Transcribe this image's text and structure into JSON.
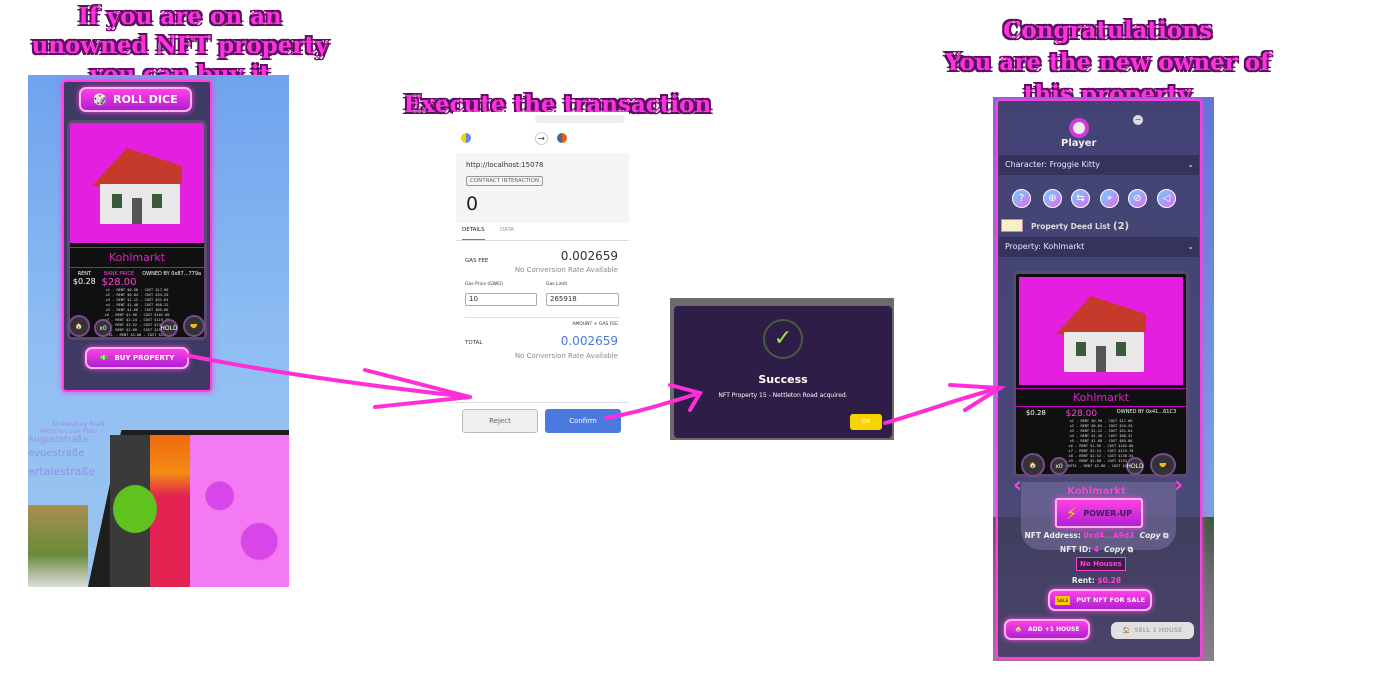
{
  "captions": {
    "step1": [
      "If you are on an",
      "unowned NFT property",
      "you can buy it"
    ],
    "step2": "Execute the transaction",
    "step3": [
      "Congratulations",
      "You are the new owner of",
      "this property"
    ]
  },
  "game_before": {
    "roll_dice_label": "ROLL DICE",
    "card": {
      "name": "Kohlmarkt",
      "rent_label": "RENT",
      "rent": "$0.28",
      "bank_price_label": "BANK PRICE",
      "bank_price": "$28.00",
      "owned_by": "OWNED BY 0x87...779a",
      "rent_rows": [
        "x1 - RENT $0.56 - COST $17.00",
        "x2 - RENT $0.84 - COST $34.20",
        "x3 - RENT $1.12 - COST $51.64",
        "x4 - RENT $1.40 - COST $68.32",
        "x5 - RENT $1.68 - COST $85.00",
        "x6 - RENT $1.96 - COST $102.00",
        "x7 - RENT $2.24 - COST $119.78",
        "x8 - RENT $2.52 - COST $136.54",
        "x9 - RENT $2.80 - COST $153.32",
        "HOTEL - RENT $3.08 - COST $19.40"
      ],
      "houses_count": "x0",
      "hold_label": "HOLD"
    },
    "buy_property_label": "BUY PROPERTY",
    "street_labels": [
      "Shrewsbury Road",
      "Viktoria-Luise-Platz",
      "Auguststraße",
      "evuestraße",
      "ertalestraße"
    ]
  },
  "metamask": {
    "origin": "http://localhost:15078",
    "badge": "CONTRACT INTERACTION",
    "amount": "0",
    "tabs": [
      "DETAILS",
      "DATA"
    ],
    "active_tab": "DETAILS",
    "gas_fee_label": "GAS FEE",
    "gas_fee": "0.002659",
    "no_rate": "No Conversion Rate Available",
    "gas_price_label": "Gas Price (GWEI)",
    "gas_price": "10",
    "gas_limit_label": "Gas Limit",
    "gas_limit": "265918",
    "amount_gas_label": "AMOUNT + GAS FEE",
    "total_label": "TOTAL",
    "total": "0.002659",
    "reject_label": "Reject",
    "confirm_label": "Confirm",
    "accent": "#4a7ae0"
  },
  "success_dialog": {
    "title": "Success",
    "message": "NFT Property 15 - Nettleton Road acquired.",
    "ok_label": "OK"
  },
  "game_after": {
    "player_label": "Player",
    "character_select": "Character: Froggie Kitty",
    "toolbar_icons": [
      "help-icon",
      "zoom-in-icon",
      "swap-icon",
      "target-icon",
      "hide-icon",
      "sound-icon"
    ],
    "deed_list_label": "Property Deed List",
    "deed_count": "(2)",
    "property_select": "Property: Kohlmarkt",
    "card": {
      "name": "Kohlmarkt",
      "rent": "$0.28",
      "bank_price": "$28.00",
      "owned_by": "OWNED BY 0x41...61C3",
      "houses_count": "x0",
      "hold_label": "HOLD"
    },
    "property_title": "Kohlmarkt",
    "power_up_label": "POWER-UP",
    "nft_address_label": "NFT Address:",
    "nft_address": "0xd4...A9d3",
    "copy_label": "Copy",
    "nft_id_label": "NFT ID:",
    "nft_id": "4",
    "houses_badge": "No Houses",
    "rent_label": "Rent:",
    "rent": "$0.28",
    "sale_label": "PUT NFT FOR SALE",
    "sale_tag": "SALE",
    "add_house_label": "ADD +1 HOUSE",
    "sell_house_label": "SELL 1 HOUSE"
  },
  "colors": {
    "accent_pink": "#ff33dd",
    "panel": "#3e3a63",
    "ok_yellow": "#f5d400"
  }
}
